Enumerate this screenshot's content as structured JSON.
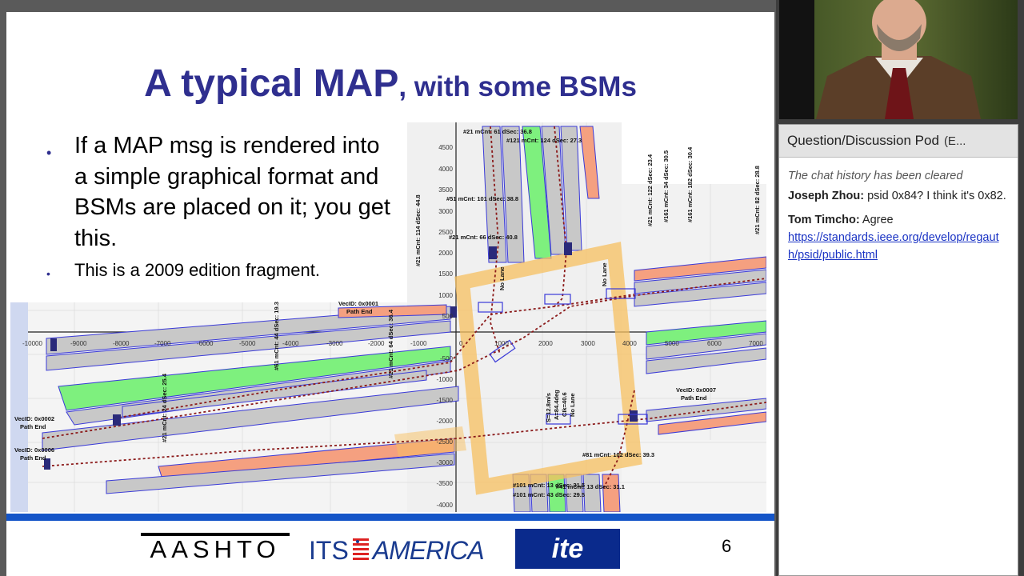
{
  "slide": {
    "title_main": "A typical MAP",
    "title_sub": ", with some BSMs",
    "bullets": [
      "If a MAP msg is rendered into a simple graphical format  and BSMs are placed on it; you get this.",
      "This is a 2009 edition fragment."
    ],
    "page_number": "6",
    "logos": {
      "aashto": "AASHTO",
      "its": "ITS",
      "america": "AMERICA",
      "ite": "ite"
    },
    "map": {
      "x_ticks": [
        "-10000",
        "-9000",
        "-8000",
        "-7000",
        "-6000",
        "-5000",
        "-4000",
        "-3000",
        "-2000",
        "-1000",
        "0",
        "1000",
        "2000",
        "3000",
        "4000",
        "5000",
        "6000",
        "7000"
      ],
      "y_ticks": [
        "4500",
        "4000",
        "3500",
        "3000",
        "2500",
        "2000",
        "1500",
        "1000",
        "500",
        "-500",
        "-1000",
        "-1500",
        "-2000",
        "-2500",
        "-3000",
        "-3500",
        "-4000"
      ],
      "labels": {
        "n1": "#21 mCnt: 61 dSec: 36.8",
        "n2": "#121 mCnt: 124 dSec: 27.3",
        "n3": "#51 mCnt: 101 dSec: 38.8",
        "n4": "#21 mCnt: 66 dSec: 40.8",
        "e1": "#21 mCnt: 122 dSec: 23.4",
        "e2": "#161 mCnt: 34 dSec: 30.5",
        "e3": "#161 mCnt: 182 dSec: 30.4",
        "e4": "#21 mCnt: 82 dSec: 28.8",
        "w0": "#21 mCnt: 114 dSec: 44.8",
        "w1": "#21 mCnt: 64 dSec: 36.4",
        "w2": "#61 mCnt: 44 dSec: 19.3",
        "w3": "#21 mCnt: 24 dSec: 25.4",
        "veh1": "VecID: 0x0001",
        "path1": "Path End",
        "veh6": "VecID: 0x0006",
        "path6": "Path End",
        "veh7": "VecID: 0x0007",
        "path7": "Path End",
        "vehW": "VecID: 0x0002",
        "pathW": "Path End",
        "s1": "#81 mCnt: 102 dSec: 39.3",
        "s2": "#101 mCnt: 13 dSec: 31.5",
        "s3": "#41 mCnt: 13 dSec: 31.1",
        "s4": "#101 mCnt: 43 dSec: 29.5",
        "speed1": "S=12.8m/s",
        "speed2": "A=84.4deg",
        "speed3": "CIk=40.6",
        "nolane": "No Lane"
      }
    }
  },
  "pod": {
    "title": "Question/Discussion Pod",
    "title_suffix": "(E...",
    "cleared_notice": "The chat history has been cleared",
    "messages": [
      {
        "author": "Joseph Zhou:",
        "text": " psid 0x84? I think it's 0x82."
      },
      {
        "author": "Tom Timcho:",
        "text": " Agree",
        "link": "https://standards.ieee.org/develop/regauth/psid/public.html"
      }
    ]
  },
  "colors": {
    "title_blue": "#2f2f8f",
    "bar_blue": "#1455c8",
    "lane_gray": "#c8c8c8",
    "lane_green": "#7ef07e",
    "lane_salmon": "#f5a080",
    "intersection_orange": "#f7c060",
    "path_red": "#8b1a1a",
    "link_blue": "#1a33c4"
  }
}
